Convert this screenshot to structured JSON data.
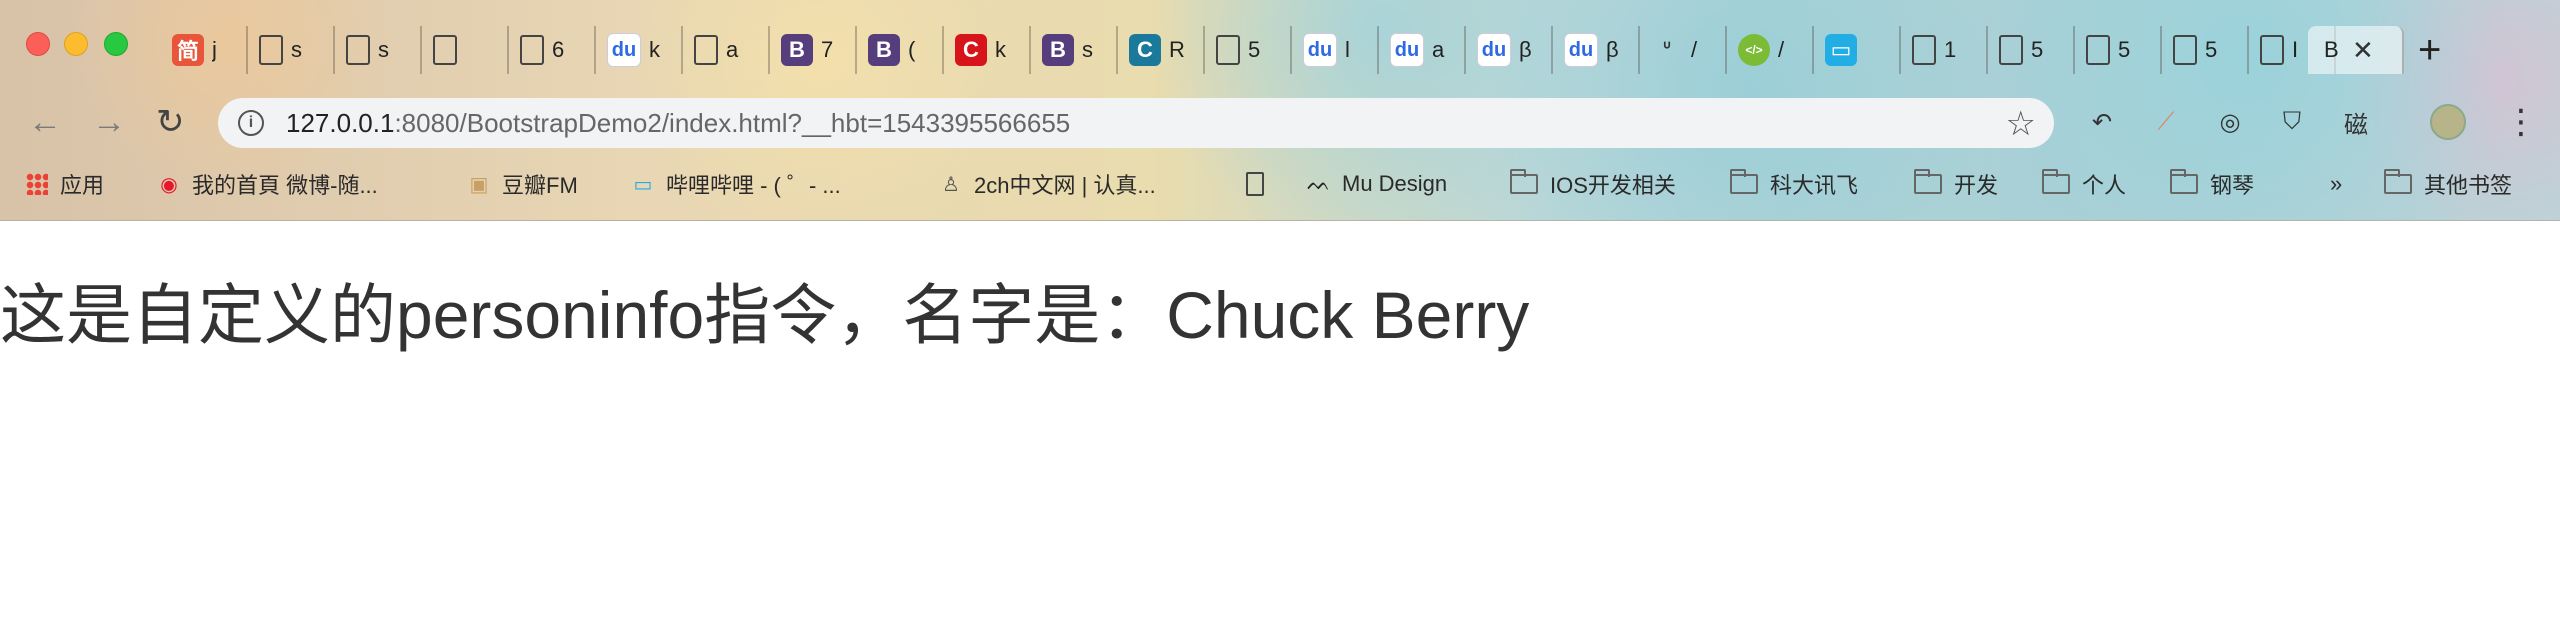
{
  "browser": {
    "tabs": [
      {
        "fav_type": "jian",
        "fav_text": "简",
        "fav_color": "#e8553b",
        "title": "j"
      },
      {
        "fav_type": "doc",
        "fav_text": "",
        "title": "s"
      },
      {
        "fav_type": "doc",
        "fav_text": "",
        "title": "s"
      },
      {
        "fav_type": "doc",
        "fav_text": "",
        "title": ""
      },
      {
        "fav_type": "doc",
        "fav_text": "",
        "title": "6"
      },
      {
        "fav_type": "baidu",
        "fav_text": "du",
        "title": "k"
      },
      {
        "fav_type": "doc",
        "fav_text": "",
        "title": "a"
      },
      {
        "fav_type": "bootstrap",
        "fav_text": "B",
        "fav_color": "#563d7c",
        "title": "7"
      },
      {
        "fav_type": "bootstrap",
        "fav_text": "B",
        "fav_color": "#563d7c",
        "title": "("
      },
      {
        "fav_type": "c",
        "fav_text": "C",
        "fav_color": "#d7141a",
        "title": "k"
      },
      {
        "fav_type": "bootstrap",
        "fav_text": "B",
        "fav_color": "#563d7c",
        "title": "s"
      },
      {
        "fav_type": "c",
        "fav_text": "C",
        "fav_color": "#1b7a9c",
        "title": "R"
      },
      {
        "fav_type": "doc",
        "fav_text": "",
        "title": "5"
      },
      {
        "fav_type": "baidu",
        "fav_text": "du",
        "title": "l"
      },
      {
        "fav_type": "baidu",
        "fav_text": "du",
        "title": "a"
      },
      {
        "fav_type": "baidu",
        "fav_text": "du",
        "title": "β"
      },
      {
        "fav_type": "baidu",
        "fav_text": "du",
        "title": "β"
      },
      {
        "fav_type": "other",
        "fav_text": "ᐡ",
        "title": "/"
      },
      {
        "fav_type": "code",
        "fav_text": "</>",
        "fav_color": "#7cbb35",
        "title": "/"
      },
      {
        "fav_type": "bili",
        "fav_text": "▭",
        "fav_color": "#23ade5",
        "title": ""
      },
      {
        "fav_type": "doc",
        "fav_text": "",
        "title": "1"
      },
      {
        "fav_type": "doc",
        "fav_text": "",
        "title": "5"
      },
      {
        "fav_type": "doc",
        "fav_text": "",
        "title": "5"
      },
      {
        "fav_type": "doc",
        "fav_text": "",
        "title": "5"
      },
      {
        "fav_type": "doc",
        "fav_text": "",
        "title": "I"
      }
    ],
    "active_tab": {
      "title": "B",
      "close": "✕"
    },
    "new_tab_label": "+",
    "url_host": "127.0.0.1",
    "url_rest": ":8080/BootstrapDemo2/index.html?__hbt=1543395566655",
    "ext_text_label": "磁"
  },
  "bookmarks": [
    {
      "icon": "apps",
      "label": "应用"
    },
    {
      "icon": "weibo",
      "label": "我的首頁 微博-随..."
    },
    {
      "icon": "douban",
      "label": "豆瓣FM"
    },
    {
      "icon": "bili",
      "label": "哔哩哔哩 - ( ゜- ..."
    },
    {
      "icon": "2ch",
      "label": "2ch中文网 | 认真..."
    },
    {
      "icon": "doc",
      "label": ""
    },
    {
      "icon": "mu",
      "label": "Mu Design"
    },
    {
      "icon": "folder",
      "label": "IOS开发相关"
    },
    {
      "icon": "folder",
      "label": "科大讯飞"
    },
    {
      "icon": "folder",
      "label": "开发"
    },
    {
      "icon": "folder",
      "label": "个人"
    },
    {
      "icon": "folder",
      "label": "钢琴"
    }
  ],
  "bookmarks_overflow": "»",
  "bookmarks_other": "其他书签",
  "page": {
    "heading": "这是自定义的personinfo指令，名字是：Chuck Berry"
  }
}
